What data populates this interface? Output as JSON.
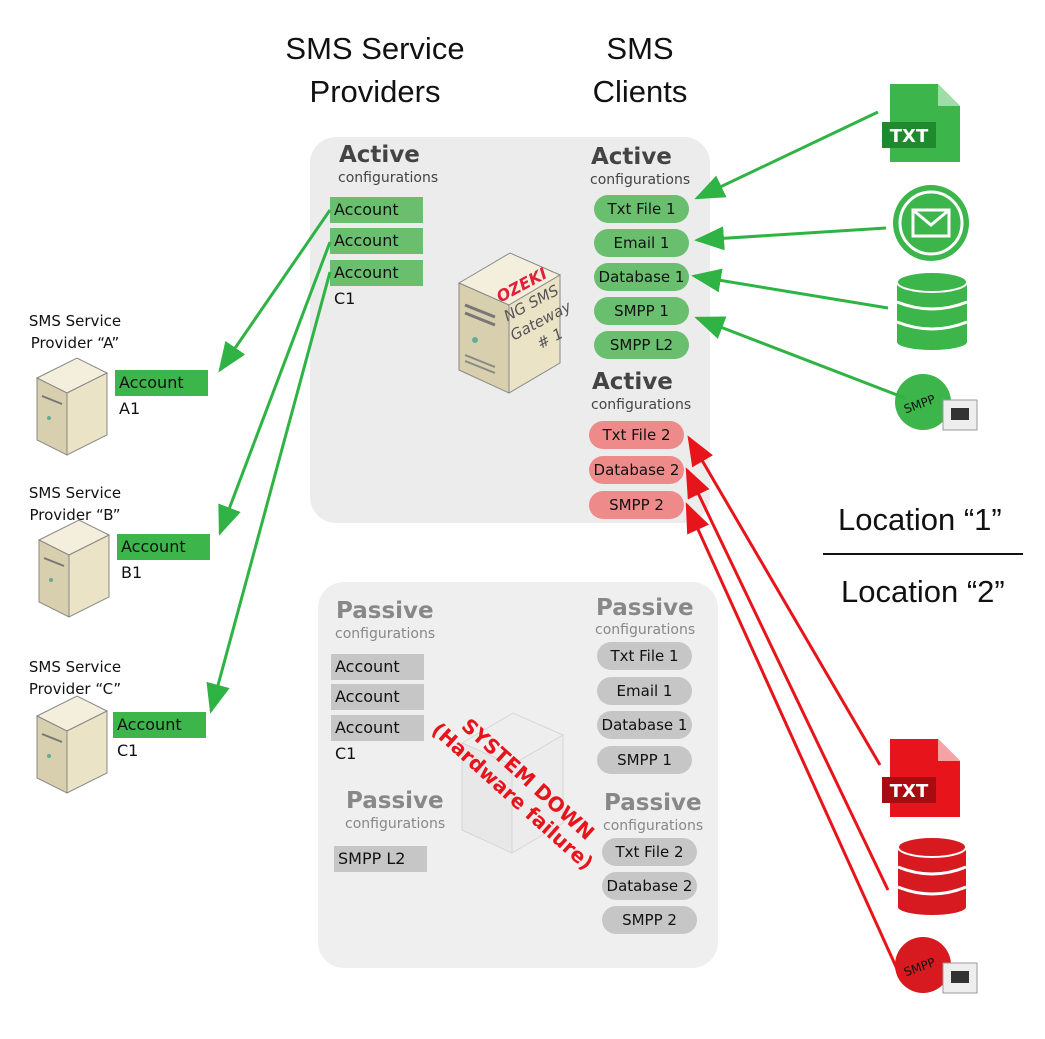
{
  "headers": {
    "providers": "SMS Service Providers",
    "clients": "SMS Clients"
  },
  "active_box": {
    "providers": {
      "title": "Active",
      "subtitle": "configurations",
      "accounts": [
        "Account A1",
        "Account B1",
        "Account C1"
      ]
    },
    "clients_1": {
      "title": "Active",
      "subtitle": "configurations",
      "items": [
        "Txt File 1",
        "Email 1",
        "Database 1",
        "SMPP 1",
        "SMPP L2"
      ]
    },
    "clients_2": {
      "title": "Active",
      "subtitle": "configurations",
      "items": [
        "Txt File 2",
        "Database 2",
        "SMPP 2"
      ]
    },
    "server_logo": "OZEKI",
    "server_label": [
      "NG SMS",
      "Gateway",
      "# 1"
    ]
  },
  "passive_box": {
    "providers": {
      "title": "Passive",
      "subtitle": "configurations",
      "accounts": [
        "Account A1",
        "Account B1",
        "Account C1"
      ]
    },
    "clients_1": {
      "title": "Passive",
      "subtitle": "configurations",
      "items": [
        "Txt File 1",
        "Email 1",
        "Database 1",
        "SMPP 1"
      ]
    },
    "extra": {
      "title": "Passive",
      "subtitle": "configurations",
      "items": [
        "SMPP L2"
      ]
    },
    "clients_2": {
      "title": "Passive",
      "subtitle": "configurations",
      "items": [
        "Txt File 2",
        "Database 2",
        "SMPP 2"
      ]
    },
    "status_line1": "SYSTEM DOWN",
    "status_line2": "(Hardware failure)"
  },
  "providers": [
    {
      "name": "SMS Service Provider “A”",
      "account": "Account A1"
    },
    {
      "name": "SMS Service Provider “B”",
      "account": "Account B1"
    },
    {
      "name": "SMS Service Provider “C”",
      "account": "Account C1"
    }
  ],
  "locations": {
    "top": "Location “1”",
    "bottom": "Location “2”"
  },
  "icons": {
    "txt": "TXT",
    "smpp": "SMPP"
  },
  "colors": {
    "active": "#6abf6e",
    "active_account": "#3cb54a",
    "failover": "#ef8a8a",
    "passive": "#c6c6c6",
    "green_arrow": "#2fb344",
    "red_arrow": "#e8141b"
  }
}
